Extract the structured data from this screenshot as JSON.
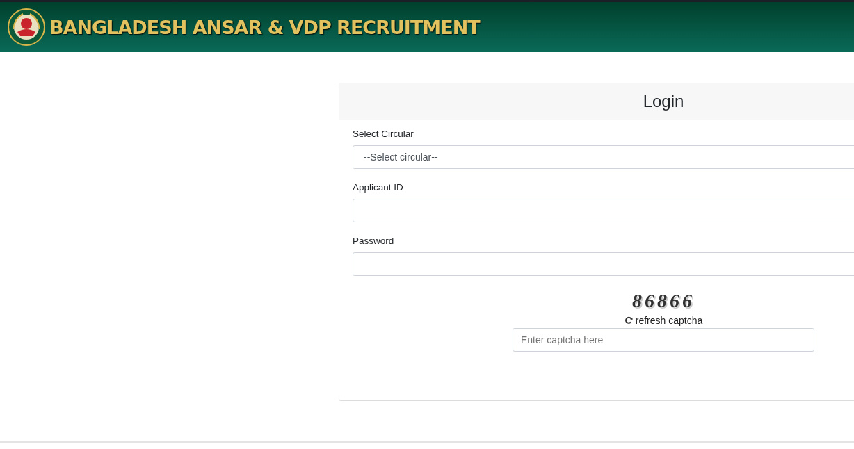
{
  "header": {
    "title": "BANGLADESH ANSAR & VDP RECRUITMENT"
  },
  "login": {
    "title": "Login",
    "fields": [
      {
        "kind": "select",
        "label": "Select Circular",
        "value": "--Select circular--"
      },
      {
        "kind": "text",
        "label": "Applicant ID"
      },
      {
        "kind": "password",
        "label": "Password"
      }
    ],
    "captcha": {
      "code": "86866",
      "refresh": "refresh captcha",
      "placeholder": "Enter captcha here"
    }
  }
}
